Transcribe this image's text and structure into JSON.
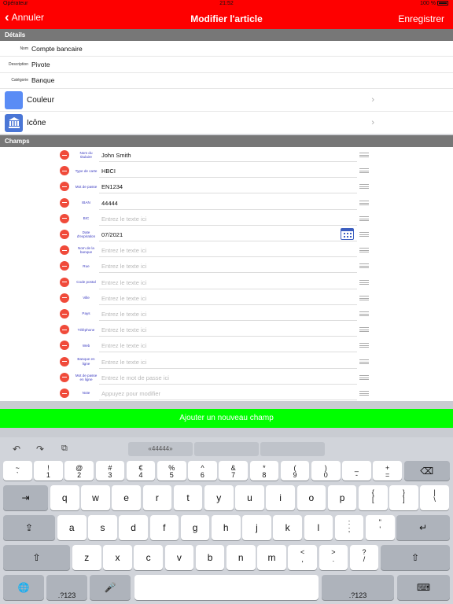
{
  "status_bar": {
    "carrier": "Opérateur",
    "time": "21:52",
    "battery": "100 %"
  },
  "navbar": {
    "back_label": "Annuler",
    "title": "Modifier l'article",
    "save_label": "Enregistrer"
  },
  "details": {
    "header": "Détails",
    "rows": [
      {
        "label": "Nom",
        "value": "Compte bancaire"
      },
      {
        "label": "Description",
        "value": "Pivote"
      },
      {
        "label": "Catégorie",
        "value": "Banque"
      }
    ],
    "color_row": {
      "label": "Couleur",
      "color": "#5a8cf5",
      "icon": "color-swatch"
    },
    "icon_row": {
      "label": "Icône",
      "color": "#4a76d6",
      "icon": "bank-icon"
    }
  },
  "fields": {
    "header": "Champs",
    "rows": [
      {
        "label": "Nom du titulaire",
        "value": "John Smith",
        "placeholder": ""
      },
      {
        "label": "Type de carte",
        "value": "HBCI",
        "placeholder": ""
      },
      {
        "label": "Mot de passe",
        "value": "EN1234",
        "placeholder": ""
      },
      {
        "label": "IBAN",
        "value": "44444",
        "placeholder": ""
      },
      {
        "label": "BIC",
        "value": "",
        "placeholder": "Entrez le texte ici"
      },
      {
        "label": "Date d'expiration",
        "value": "07/2021",
        "placeholder": ""
      },
      {
        "label": "Nom de la banque",
        "value": "",
        "placeholder": "Entrez le texte ici"
      },
      {
        "label": "Rue",
        "value": "",
        "placeholder": "Entrez le texte ici"
      },
      {
        "label": "Code postal",
        "value": "",
        "placeholder": "Entrez le texte ici"
      },
      {
        "label": "Ville",
        "value": "",
        "placeholder": "Entrez le texte ici"
      },
      {
        "label": "Pays",
        "value": "",
        "placeholder": "Entrez le texte ici"
      },
      {
        "label": "Téléphone",
        "value": "",
        "placeholder": "Entrez le texte ici"
      },
      {
        "label": "Web",
        "value": "",
        "placeholder": "Entrez le texte ici"
      },
      {
        "label": "Banque en ligne",
        "value": "",
        "placeholder": "Entrez le texte ici"
      },
      {
        "label": "Mot de passe en ligne",
        "value": "",
        "placeholder": "Entrez le mot de passe ici"
      },
      {
        "label": "Note",
        "value": "",
        "placeholder": "Appuyez pour modifier"
      }
    ],
    "add_button": "Ajouter un nouveau champ"
  },
  "colors": {
    "nav_red": "#fe0000",
    "add_green": "#00ff00",
    "delete_red": "#f04a3a",
    "label_blue": "#3a3ac0"
  },
  "keyboard": {
    "suggestion": "«44444»",
    "number_row": [
      {
        "top": "~",
        "bottom": "`"
      },
      {
        "top": "!",
        "bottom": "1"
      },
      {
        "top": "@",
        "bottom": "2"
      },
      {
        "top": "#",
        "bottom": "3"
      },
      {
        "top": "€",
        "bottom": "4"
      },
      {
        "top": "%",
        "bottom": "5"
      },
      {
        "top": "^",
        "bottom": "6"
      },
      {
        "top": "&",
        "bottom": "7"
      },
      {
        "top": "*",
        "bottom": "8"
      },
      {
        "top": "(",
        "bottom": "9"
      },
      {
        "top": ")",
        "bottom": "0"
      },
      {
        "top": "_",
        "bottom": "-"
      },
      {
        "top": "+",
        "bottom": "="
      }
    ],
    "row_q": [
      "q",
      "w",
      "e",
      "r",
      "t",
      "y",
      "u",
      "i",
      "o",
      "p"
    ],
    "row_q_extra": [
      {
        "top": "{",
        "bottom": "["
      },
      {
        "top": "}",
        "bottom": "]"
      },
      {
        "top": "|",
        "bottom": "\\"
      }
    ],
    "row_a": [
      "a",
      "s",
      "d",
      "f",
      "g",
      "h",
      "j",
      "k",
      "l"
    ],
    "row_a_extra": [
      {
        "top": ":",
        "bottom": ";"
      },
      {
        "top": "\"",
        "bottom": "'"
      }
    ],
    "row_z": [
      "z",
      "x",
      "c",
      "v",
      "b",
      "n",
      "m"
    ],
    "row_z_extra": [
      {
        "top": "<",
        "bottom": ","
      },
      {
        "top": ">",
        "bottom": "."
      },
      {
        "top": "?",
        "bottom": "/"
      }
    ],
    "numbers_label": ".?123"
  }
}
